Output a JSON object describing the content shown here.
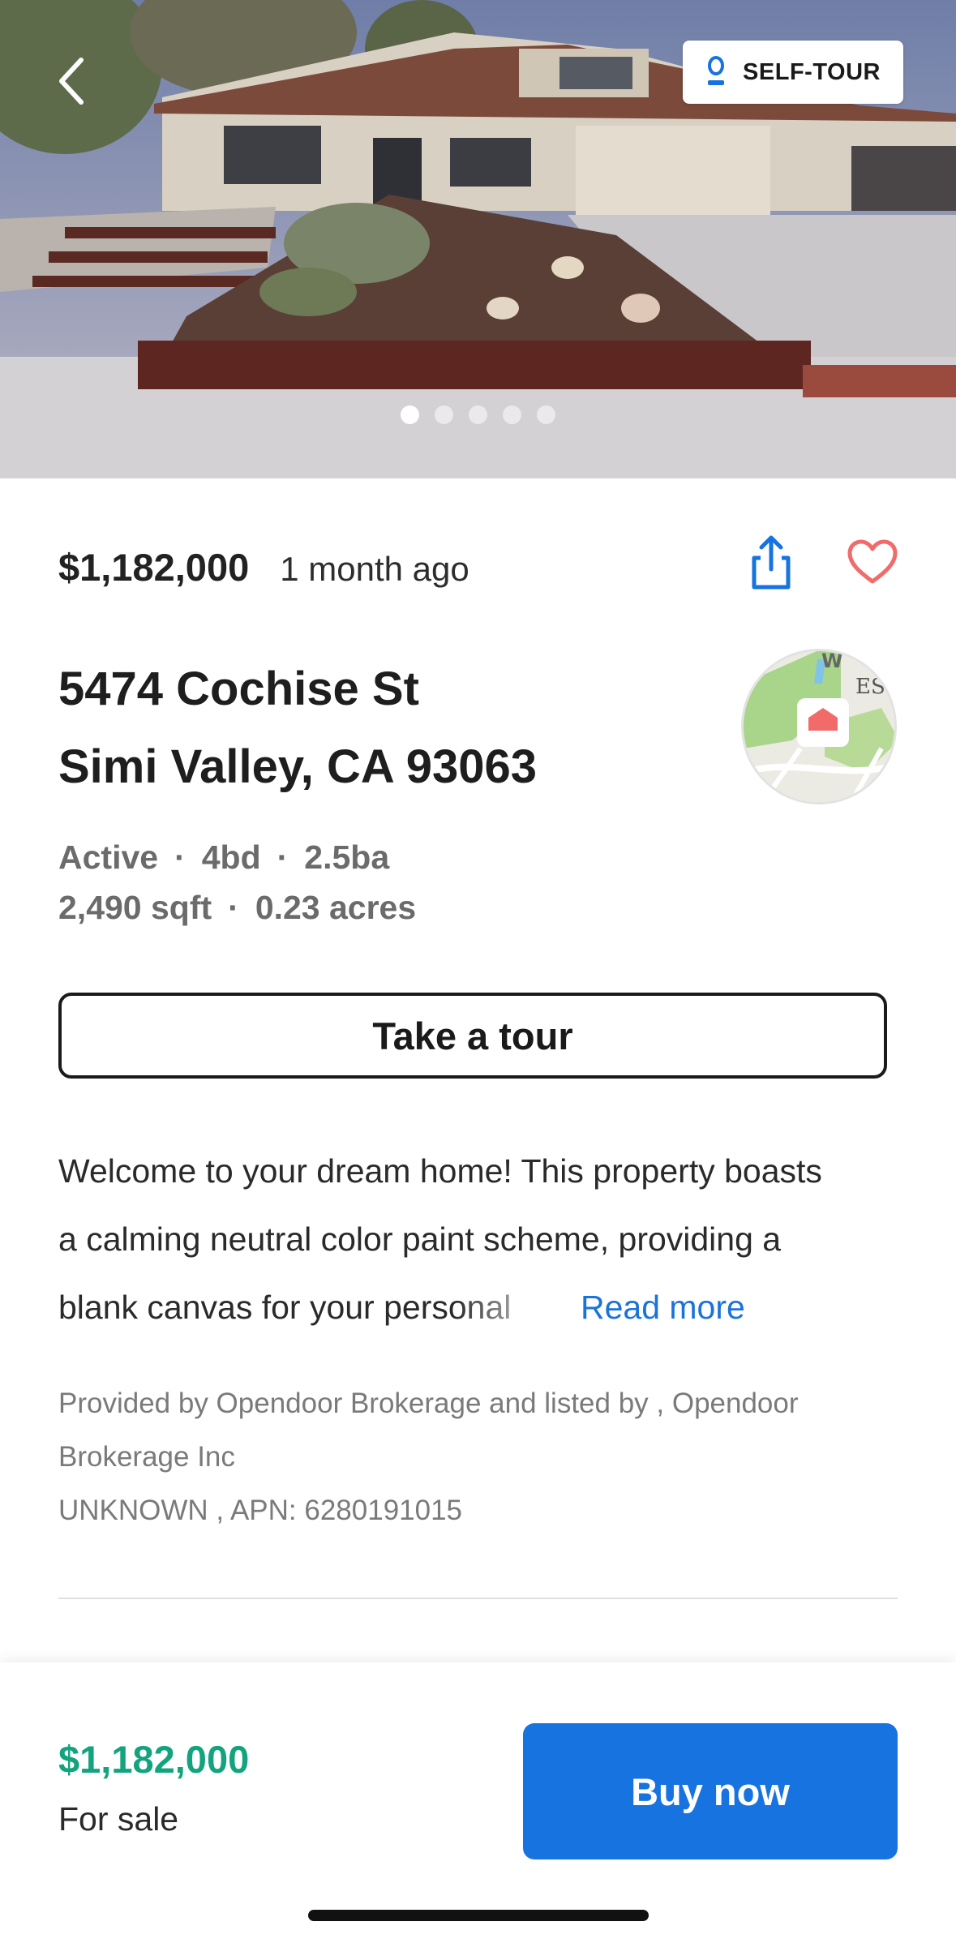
{
  "hero": {
    "photo_count": 5,
    "active_photo_index": 0,
    "self_tour_label": "SELF-TOUR",
    "back_icon": "chevron-left-icon",
    "self_tour_icon": "key-icon"
  },
  "listing": {
    "price": "$1,182,000",
    "posted": "1 month ago",
    "address_line1": "5474 Cochise St",
    "address_line2": "Simi Valley, CA 93063",
    "status": "Active",
    "beds": "4bd",
    "baths": "2.5ba",
    "sqft": "2,490 sqft",
    "lot": "0.23 acres",
    "map_labels": [
      "W",
      "ES"
    ]
  },
  "actions": {
    "share_icon": "share-icon",
    "favorite_icon": "heart-icon",
    "tour_label": "Take a tour"
  },
  "description": {
    "line1": "Welcome to your dream home! This property boasts",
    "line2": "a calming neutral color paint scheme, providing a",
    "line3": "blank canvas for your personal",
    "read_more": "Read more"
  },
  "provenance": {
    "line1": "Provided by Opendoor Brokerage and listed by   , Opendoor",
    "line2": "Brokerage Inc",
    "line3": "UNKNOWN , APN: 6280191015"
  },
  "bottom_bar": {
    "price": "$1,182,000",
    "status": "For sale",
    "buy_label": "Buy now"
  },
  "colors": {
    "accent_blue": "#1673e0",
    "price_green": "#14a37f",
    "heart_red": "#f26b6b"
  }
}
